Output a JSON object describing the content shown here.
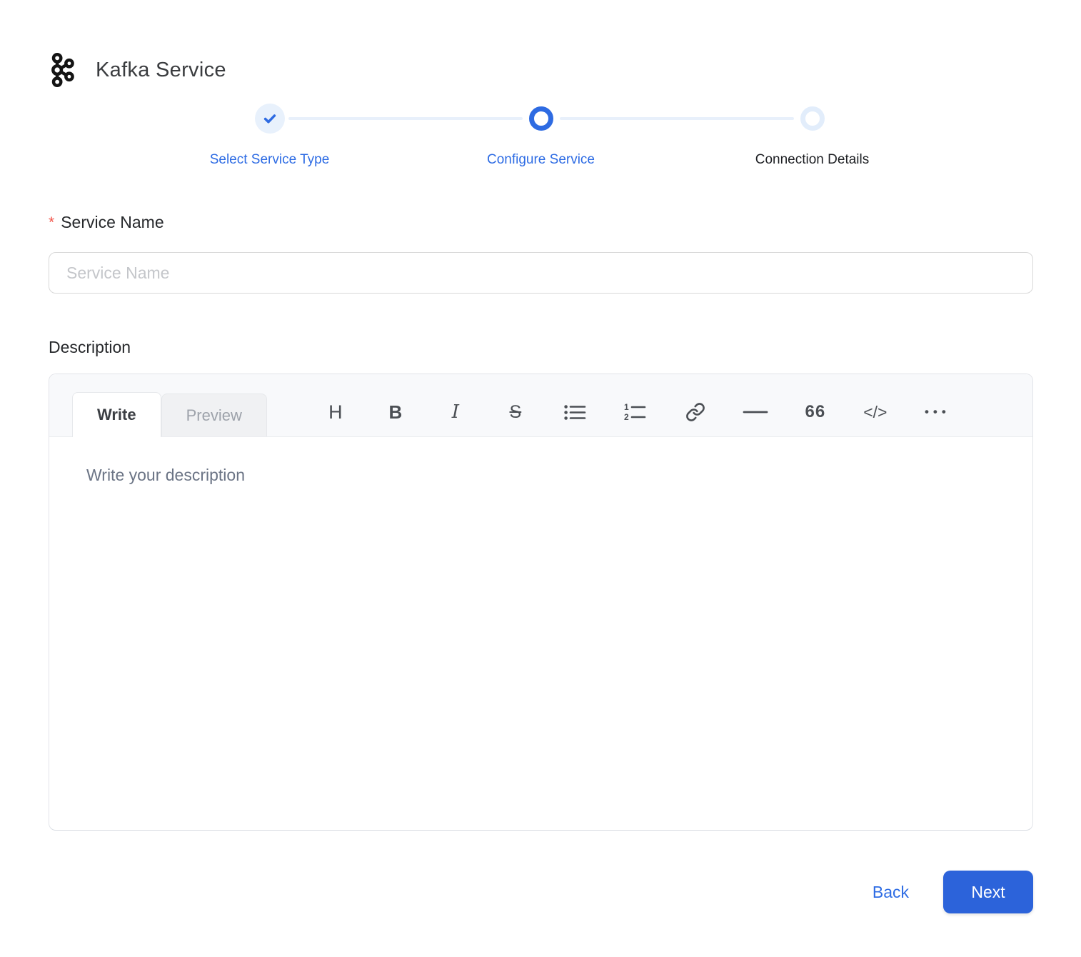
{
  "header": {
    "title": "Kafka Service",
    "icon": "kafka-logo-icon"
  },
  "stepper": {
    "steps": [
      {
        "label": "Select Service Type",
        "state": "completed"
      },
      {
        "label": "Configure Service",
        "state": "active"
      },
      {
        "label": "Connection Details",
        "state": "upcoming"
      }
    ]
  },
  "form": {
    "service_name": {
      "label": "Service Name",
      "required_marker": "*",
      "placeholder": "Service Name",
      "value": ""
    },
    "description": {
      "label": "Description",
      "placeholder": "Write your description",
      "value": ""
    }
  },
  "editor": {
    "tabs": [
      {
        "label": "Write",
        "active": true
      },
      {
        "label": "Preview",
        "active": false
      }
    ],
    "toolbar_glyphs": {
      "heading": "H",
      "bold": "B",
      "italic": "I",
      "strikethrough": "S",
      "quote": "66",
      "code": "</>",
      "more": "•••"
    },
    "toolbar_icons": [
      "heading",
      "bold",
      "italic",
      "strikethrough",
      "unordered-list",
      "ordered-list",
      "link",
      "horizontal-rule",
      "quote",
      "code",
      "more"
    ]
  },
  "footer": {
    "back_label": "Back",
    "next_label": "Next"
  },
  "colors": {
    "primary": "#2e6ce4",
    "primary_button": "#2c63da",
    "step_done_bg": "#e8f1fc",
    "step_upcoming_ring": "#e2edfb",
    "connector": "#e8f0fb",
    "required_red": "#f2554a",
    "editor_header_bg": "#f8f9fb",
    "border_light": "#e2e4e9"
  }
}
